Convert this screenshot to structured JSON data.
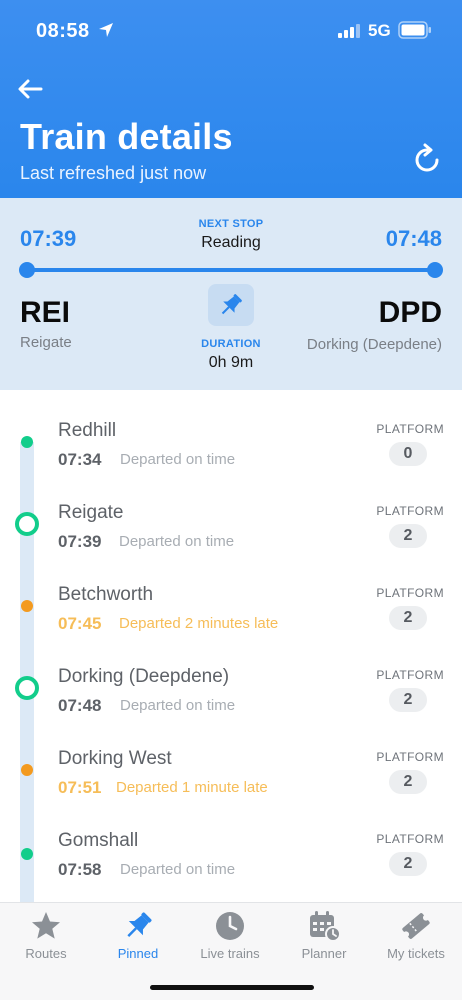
{
  "status_bar": {
    "time": "08:58",
    "network": "5G"
  },
  "header": {
    "title": "Train details",
    "subtitle": "Last refreshed just now"
  },
  "summary": {
    "departure_time": "07:39",
    "arrival_time": "07:48",
    "next_stop_label": "NEXT STOP",
    "next_stop": "Reading",
    "from_code": "REI",
    "from_name": "Reigate",
    "to_code": "DPD",
    "to_name": "Dorking (Deepdene)",
    "duration_label": "DURATION",
    "duration": "0h 9m"
  },
  "stops": [
    {
      "name": "Redhill",
      "time": "07:34",
      "status": "Departed on time",
      "platform_label": "PLATFORM",
      "platform": "0",
      "marker": "dot-green",
      "late": false
    },
    {
      "name": "Reigate",
      "time": "07:39",
      "status": "Departed on time",
      "platform_label": "PLATFORM",
      "platform": "2",
      "marker": "ring-green",
      "late": false
    },
    {
      "name": "Betchworth",
      "time": "07:45",
      "status": "Departed 2 minutes late",
      "platform_label": "PLATFORM",
      "platform": "2",
      "marker": "dot-orange",
      "late": true
    },
    {
      "name": "Dorking (Deepdene)",
      "time": "07:48",
      "status": "Departed on time",
      "platform_label": "PLATFORM",
      "platform": "2",
      "marker": "ring-green",
      "late": false
    },
    {
      "name": "Dorking West",
      "time": "07:51",
      "status": "Departed 1 minute late",
      "platform_label": "PLATFORM",
      "platform": "2",
      "marker": "dot-orange",
      "late": true
    },
    {
      "name": "Gomshall",
      "time": "07:58",
      "status": "Departed on time",
      "platform_label": "PLATFORM",
      "platform": "2",
      "marker": "dot-green",
      "late": false
    }
  ],
  "tabs": [
    {
      "label": "Routes",
      "icon": "star-icon",
      "active": false
    },
    {
      "label": "Pinned",
      "icon": "pin-icon",
      "active": true
    },
    {
      "label": "Live trains",
      "icon": "clock-icon",
      "active": false
    },
    {
      "label": "Planner",
      "icon": "calendar-icon",
      "active": false
    },
    {
      "label": "My tickets",
      "icon": "ticket-icon",
      "active": false
    }
  ],
  "colors": {
    "accent": "#2a86ec",
    "on_time": "#12cd8b",
    "late": "#f39a1f",
    "summary_bg": "#dce9f6"
  }
}
